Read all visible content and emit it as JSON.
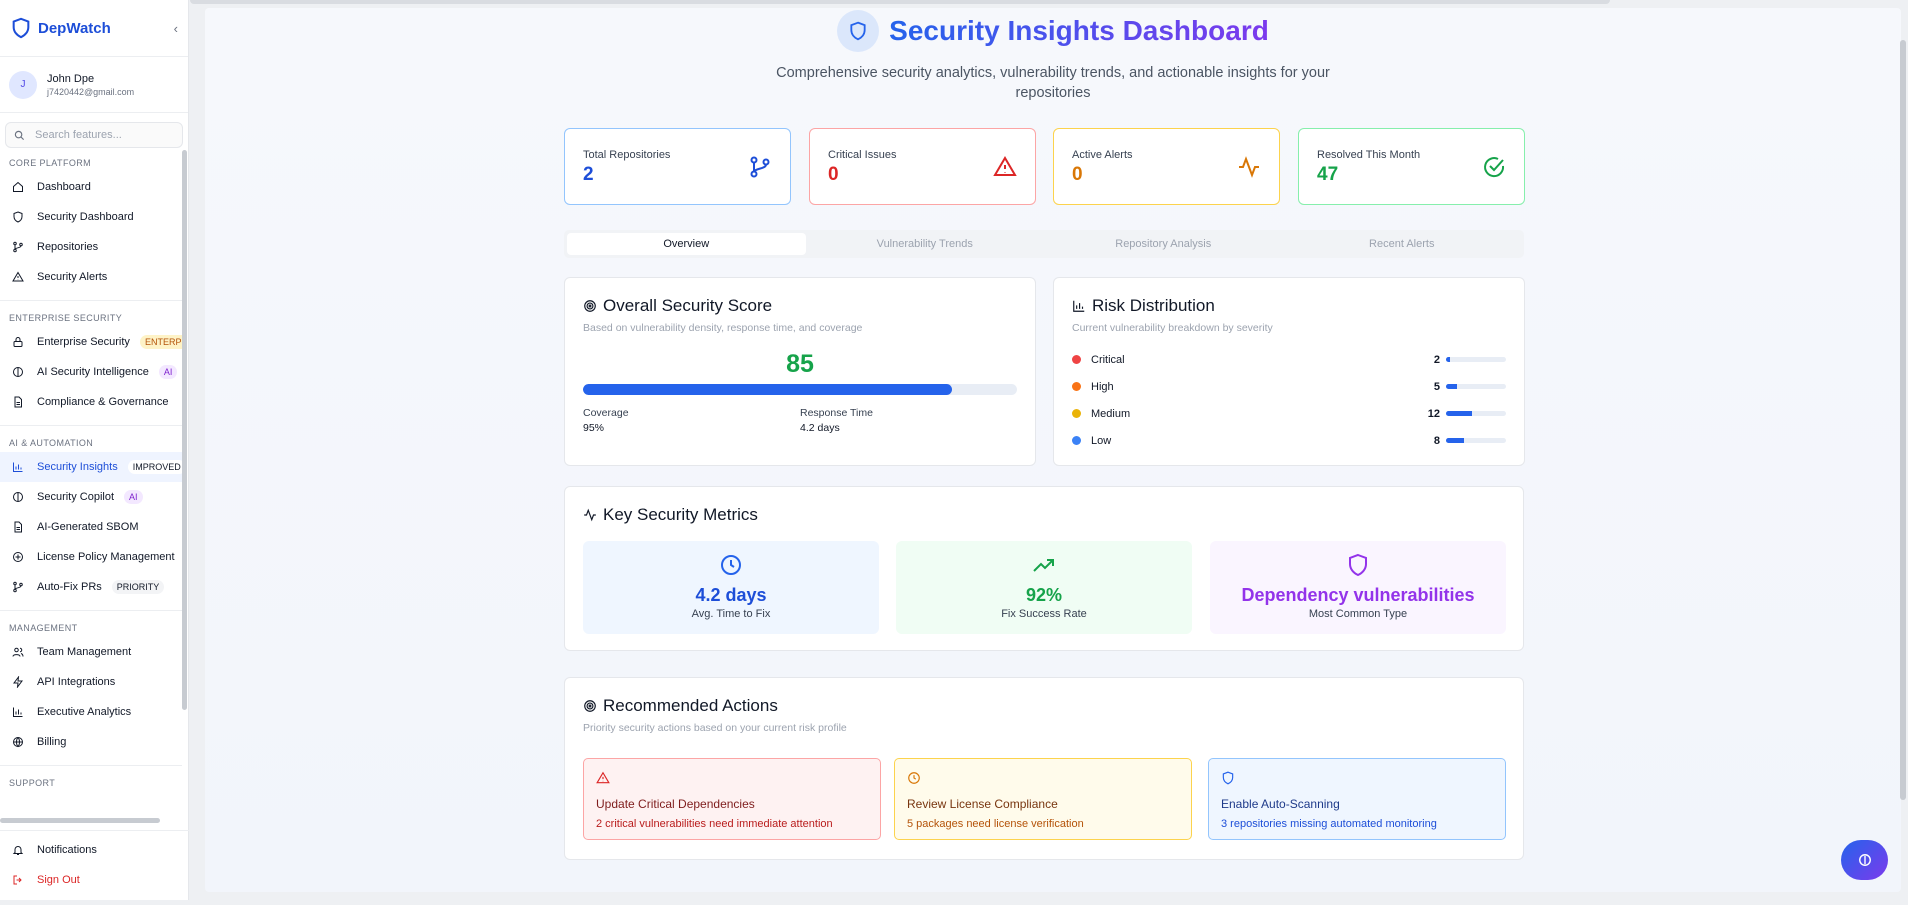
{
  "brand": {
    "name": "DepWatch",
    "collapse_icon": "chevron-left-icon"
  },
  "user": {
    "initial": "J",
    "name": "John Dpe",
    "email": "j7420442@gmail.com"
  },
  "search": {
    "placeholder": "Search features..."
  },
  "sidebar": {
    "sections": [
      {
        "title": "CORE PLATFORM",
        "items": [
          {
            "label": "Dashboard",
            "icon": "home-icon"
          },
          {
            "label": "Security Dashboard",
            "icon": "shield-icon"
          },
          {
            "label": "Repositories",
            "icon": "git-branch-icon"
          },
          {
            "label": "Security Alerts",
            "icon": "alert-triangle-icon"
          }
        ]
      },
      {
        "title": "ENTERPRISE SECURITY",
        "items": [
          {
            "label": "Enterprise Security",
            "icon": "lock-icon",
            "badge": "ENTERPRISE"
          },
          {
            "label": "AI Security Intelligence",
            "icon": "brain-icon",
            "badge": "AI"
          },
          {
            "label": "Compliance & Governance",
            "icon": "document-icon"
          }
        ]
      },
      {
        "title": "AI & AUTOMATION",
        "items": [
          {
            "label": "Security Insights",
            "icon": "bar-chart-icon",
            "badge": "IMPROVED",
            "active": true
          },
          {
            "label": "Security Copilot",
            "icon": "brain-icon",
            "badge": "AI"
          },
          {
            "label": "AI-Generated SBOM",
            "icon": "document-icon"
          },
          {
            "label": "License Policy Management",
            "icon": "scale-icon"
          },
          {
            "label": "Auto-Fix PRs",
            "icon": "git-branch-icon",
            "badge": "PRIORITY"
          }
        ]
      },
      {
        "title": "MANAGEMENT",
        "items": [
          {
            "label": "Team Management",
            "icon": "users-icon"
          },
          {
            "label": "API Integrations",
            "icon": "zap-icon"
          },
          {
            "label": "Executive Analytics",
            "icon": "bar-chart-icon"
          },
          {
            "label": "Billing",
            "icon": "globe-icon"
          }
        ]
      },
      {
        "title": "SUPPORT",
        "items": []
      }
    ],
    "bottom": {
      "notifications": "Notifications",
      "sign_out": "Sign Out"
    }
  },
  "header": {
    "title": "Security Insights Dashboard",
    "subtitle": "Comprehensive security analytics, vulnerability trends, and actionable insights for your repositories"
  },
  "stats": [
    {
      "label": "Total Repositories",
      "value": "2",
      "icon": "git-branch-icon",
      "color": "#1d4ed8"
    },
    {
      "label": "Critical Issues",
      "value": "0",
      "icon": "alert-triangle-icon",
      "color": "#dc2626"
    },
    {
      "label": "Active Alerts",
      "value": "0",
      "icon": "activity-icon",
      "color": "#d97706"
    },
    {
      "label": "Resolved This Month",
      "value": "47",
      "icon": "check-circle-icon",
      "color": "#16a34a"
    }
  ],
  "tabs": [
    "Overview",
    "Vulnerability Trends",
    "Repository Analysis",
    "Recent Alerts"
  ],
  "active_tab": "Overview",
  "score": {
    "title": "Overall Security Score",
    "subtitle": "Based on vulnerability density, response time, and coverage",
    "value": "85",
    "progress_fraction": 0.85,
    "coverage_label": "Coverage",
    "coverage_value": "95%",
    "response_label": "Response Time",
    "response_value": "4.2 days"
  },
  "risk": {
    "title": "Risk Distribution",
    "subtitle": "Current vulnerability breakdown by severity",
    "rows": [
      {
        "label": "Critical",
        "count": "2",
        "fraction": 0.07,
        "dot": "#ef4444"
      },
      {
        "label": "High",
        "count": "5",
        "fraction": 0.19,
        "dot": "#f97316"
      },
      {
        "label": "Medium",
        "count": "12",
        "fraction": 0.44,
        "dot": "#eab308"
      },
      {
        "label": "Low",
        "count": "8",
        "fraction": 0.3,
        "dot": "#3b82f6"
      }
    ]
  },
  "metrics": {
    "title": "Key Security Metrics",
    "items": [
      {
        "value": "4.2 days",
        "label": "Avg. Time to Fix",
        "icon": "clock-icon",
        "color": "#1d4ed8",
        "bg": "#eff6ff"
      },
      {
        "value": "92%",
        "label": "Fix Success Rate",
        "icon": "trending-up-icon",
        "color": "#16a34a",
        "bg": "#f0fdf4"
      },
      {
        "value": "Dependency vulnerabilities",
        "label": "Most Common Type",
        "icon": "shield-icon",
        "color": "#9333ea",
        "bg": "#faf5ff"
      }
    ]
  },
  "actions": {
    "title": "Recommended Actions",
    "subtitle": "Priority security actions based on your current risk profile",
    "items": [
      {
        "title": "Update Critical Dependencies",
        "desc": "2 critical vulnerabilities need immediate attention",
        "icon": "alert-triangle-icon"
      },
      {
        "title": "Review License Compliance",
        "desc": "5 packages need license verification",
        "icon": "clock-icon"
      },
      {
        "title": "Enable Auto-Scanning",
        "desc": "3 repositories missing automated monitoring",
        "icon": "shield-icon"
      }
    ]
  },
  "fab_icon": "brain-icon"
}
